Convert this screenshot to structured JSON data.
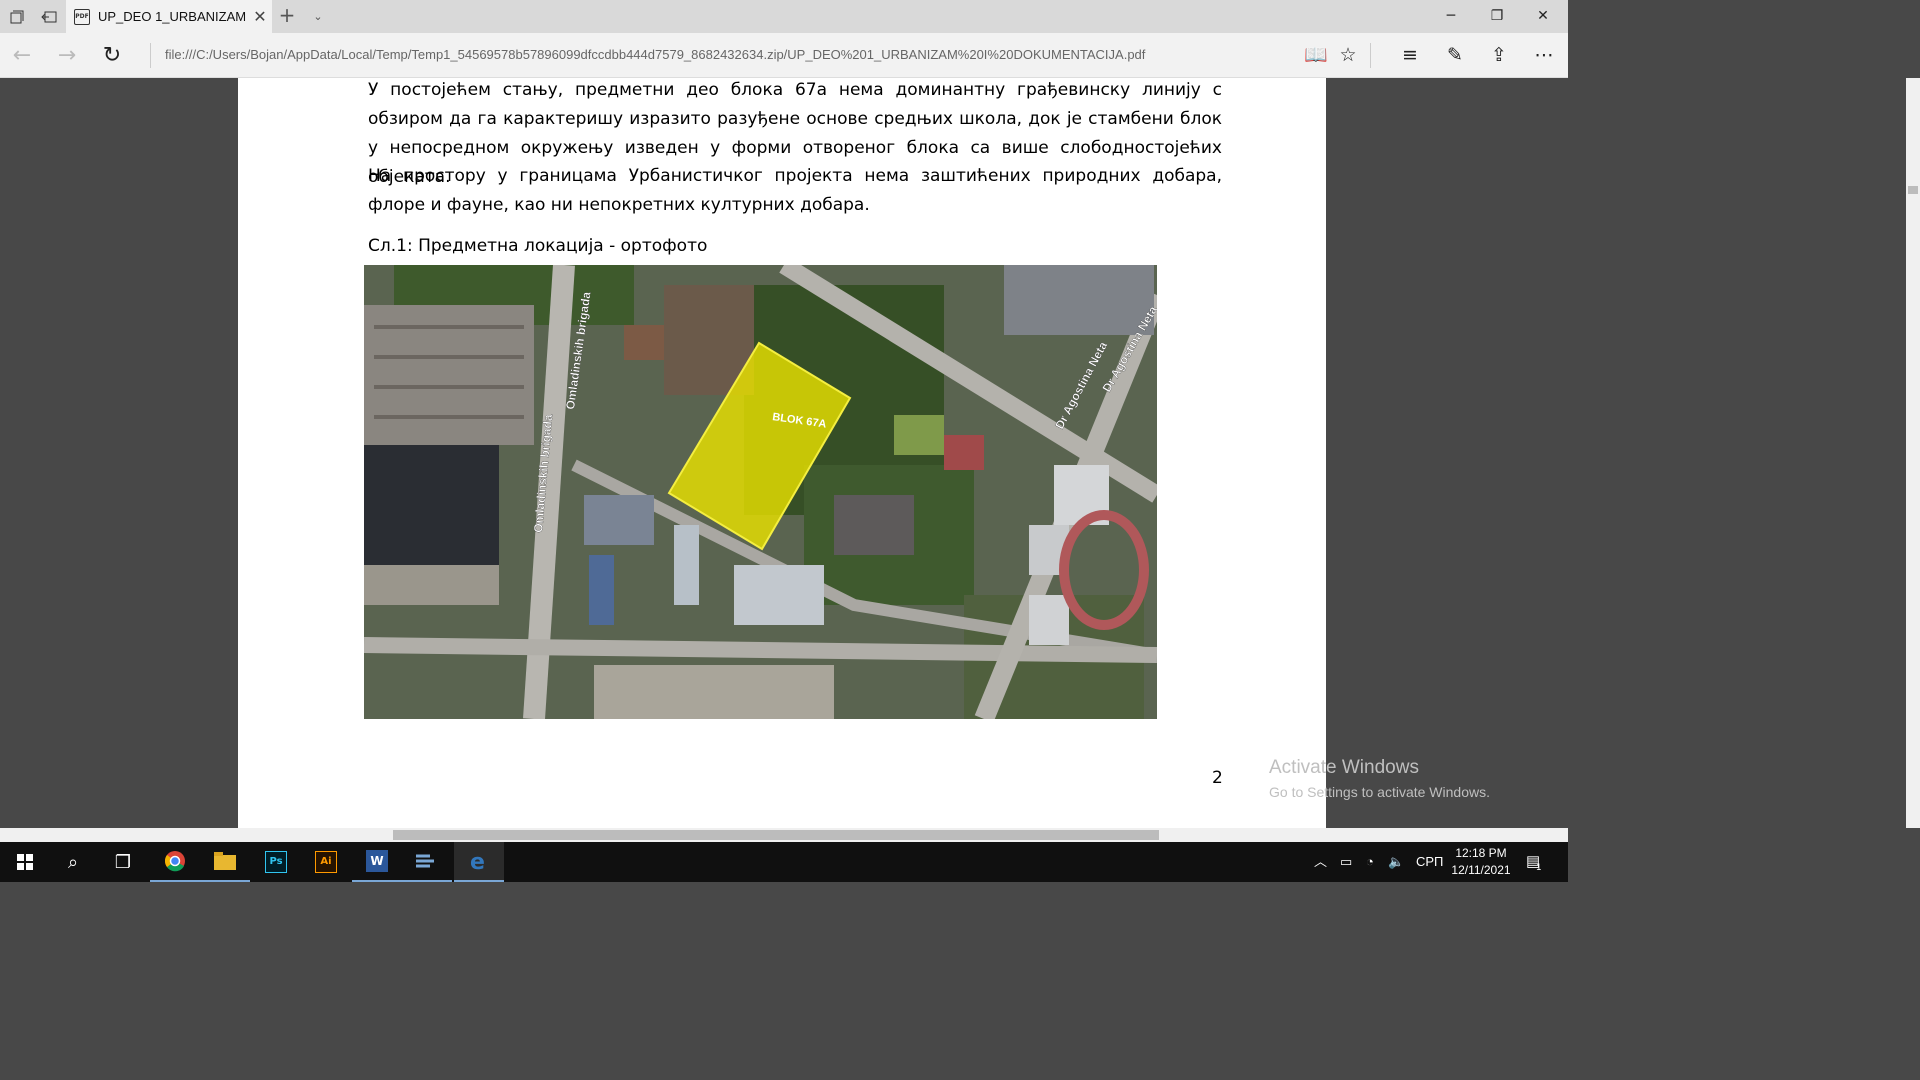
{
  "browser": {
    "tab_title": "UP_DEO 1_URBANIZAM",
    "tab_icon": "pdf-icon",
    "url": "file:///C:/Users/Bojan/AppData/Local/Temp/Temp1_54569578b57896099dfccdbb444d7579_8682432634.zip/UP_DEO%201_URBANIZAM%20I%20DOKUMENTACIJA.pdf"
  },
  "document": {
    "paragraph1": "У постојећем стању, предметни део блока 67а нема доминантну грађевинску линију с обзиром да га карактеришу изразито разуђене основе средњих школа, док је стамбени блок у непосредном окружењу изведен у форми отвореног блока са више слободностојећих објеката.",
    "paragraph2": "На простору у границама Урбанистичког пројекта нема заштићених природних добара, флоре и фауне, као ни непокретних културних добара.",
    "caption": "Сл.1: Предметна локација - ортофото",
    "map_labels": {
      "street1": "Omladinskih brigada",
      "street2": "Omladinskih brigada",
      "street3": "Dr Agostina Neta",
      "street4": "Dr Agostina Neta",
      "block": "BLOK 67A"
    },
    "page_number": "2"
  },
  "watermark": {
    "line1": "Activate Windows",
    "line2": "Go to Settings to activate Windows."
  },
  "taskbar": {
    "lang": "СРП",
    "time": "12:18 PM",
    "date": "12/11/2021",
    "notification_count": "1"
  },
  "colors": {
    "highlight": "#e8e000",
    "taskbar_accent": "#7aa7d6"
  }
}
